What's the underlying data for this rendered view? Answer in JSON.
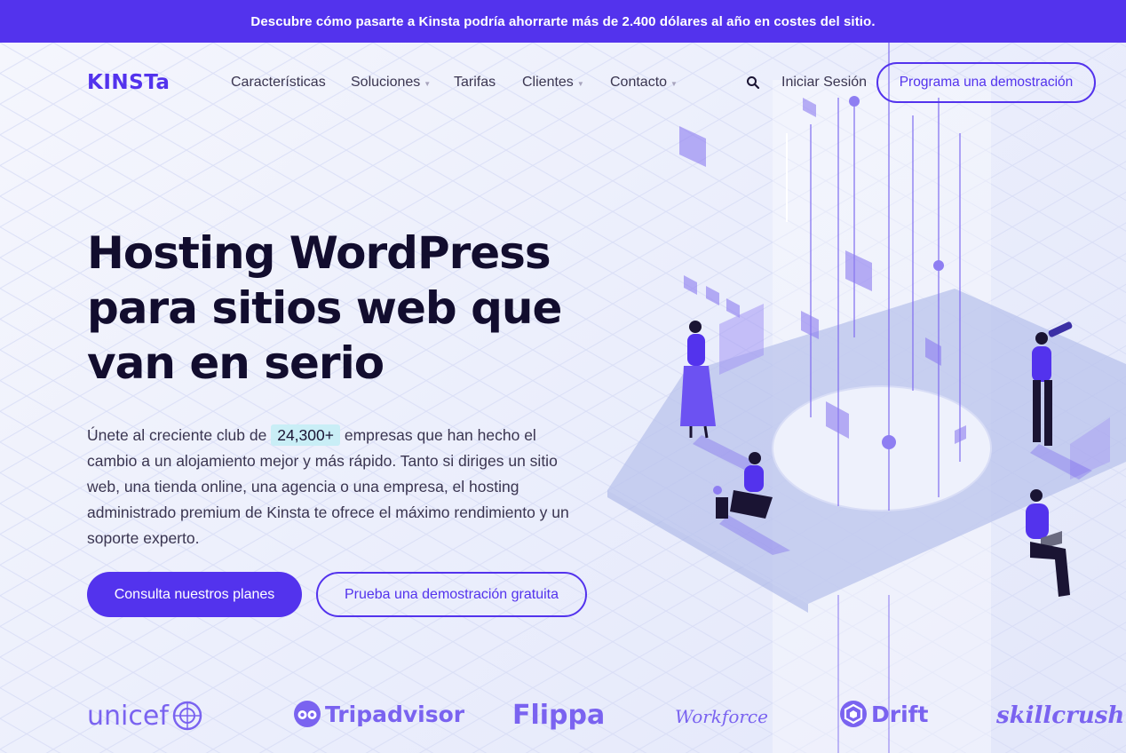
{
  "promo": {
    "text": "Descubre cómo pasarte a Kinsta podría ahorrarte más de 2.400 dólares al año en costes del sitio."
  },
  "header": {
    "logo": "KINSTa",
    "nav": [
      {
        "label": "Características",
        "has_caret": false
      },
      {
        "label": "Soluciones",
        "has_caret": true
      },
      {
        "label": "Tarifas",
        "has_caret": false
      },
      {
        "label": "Clientes",
        "has_caret": true
      },
      {
        "label": "Contacto",
        "has_caret": true
      }
    ],
    "caret": "▼",
    "search_icon": "search-icon",
    "login": "Iniciar Sesión",
    "demo_button": "Programa una demostración"
  },
  "hero": {
    "title_line1": "Hosting WordPress",
    "title_line2": "para sitios web que",
    "title_line3": "van en serio",
    "desc_before": "Únete al creciente club de ",
    "desc_highlight": "24,300+",
    "desc_after": " empresas que han hecho el cambio a un alojamiento mejor y más rápido. Tanto si diriges un sitio web, una tienda online, una agencia o una empresa, el hosting administrado premium de Kinsta te ofrece el máximo rendimiento y un soporte experto.",
    "primary_cta": "Consulta nuestros planes",
    "secondary_cta": "Prueba una demostración gratuita"
  },
  "logos": {
    "unicef": "unicef",
    "tripadvisor": "Tripadvisor",
    "flippa": "Flippa",
    "workforce": "Workforce",
    "drift": "Drift",
    "skillcrush": "skillcrush"
  },
  "colors": {
    "brand": "#5333ed",
    "heading": "#120d2e",
    "highlight": "#c9eef6"
  }
}
